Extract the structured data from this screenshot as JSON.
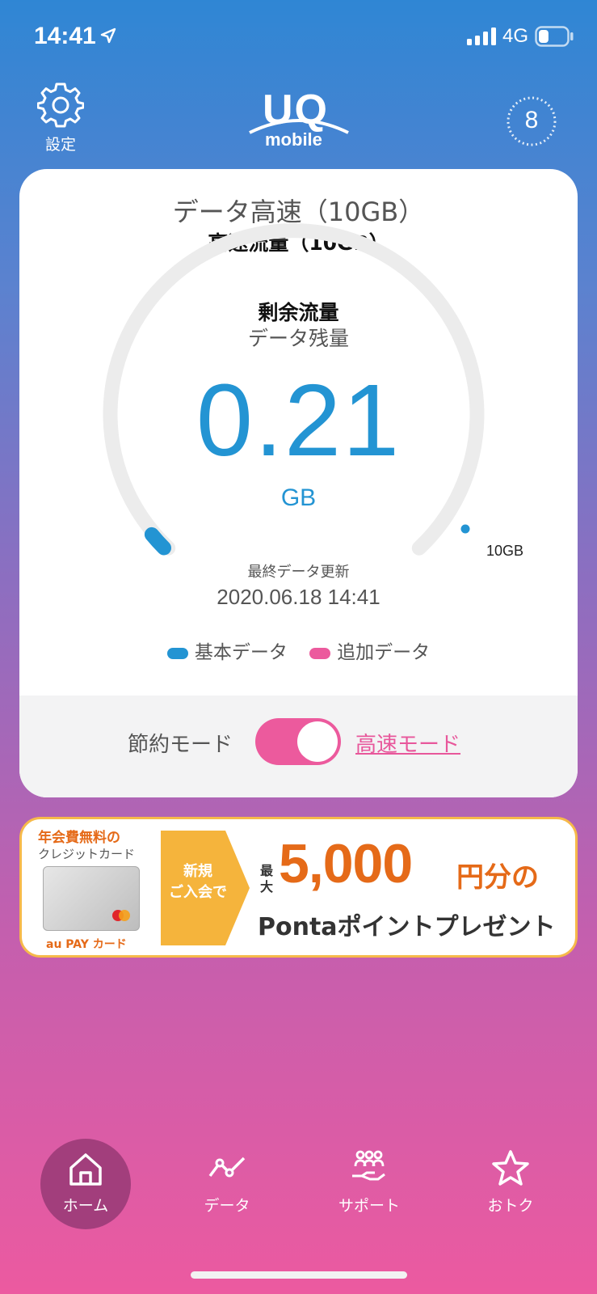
{
  "status_bar": {
    "time": "14:41",
    "network": "4G",
    "battery_level": 0.35,
    "signal_bars": 4
  },
  "header": {
    "settings_label": "設定",
    "logo_top": "UQ",
    "logo_bottom": "mobile",
    "counter": "8"
  },
  "card": {
    "plan_title": "データ高速（10GB）",
    "plan_subtitle": "高速流量（10GB）",
    "remain_label_cn": "剰余流量",
    "remain_label": "データ残量",
    "remain_value": "0.21",
    "remain_unit": "GB",
    "capacity_label": "10GB",
    "remaining_fraction": 0.021,
    "updated_label": "最終データ更新",
    "updated_value": "2020.06.18 14:41",
    "legend": [
      {
        "label": "基本データ",
        "color": "#2394d3"
      },
      {
        "label": "追加データ",
        "color": "#ec5a9d"
      }
    ],
    "mode_left": "節約モード",
    "mode_right": "高速モード",
    "mode_on": true
  },
  "banner": {
    "left_top": "年会費無料の",
    "left_top2": "クレジットカード",
    "brand": "au PAY カード",
    "arrow_text_1": "新規",
    "arrow_text_2": "ご入会で",
    "max_label": "最大",
    "amount": "5,000",
    "amount_suffix": "円分の",
    "bottom_text": "Pontaポイントプレゼント"
  },
  "nav": {
    "items": [
      {
        "label": "ホーム",
        "icon": "home-icon",
        "active": true
      },
      {
        "label": "データ",
        "icon": "chart-line-icon",
        "active": false
      },
      {
        "label": "サポート",
        "icon": "support-icon",
        "active": false
      },
      {
        "label": "おトク",
        "icon": "star-icon",
        "active": false
      }
    ]
  },
  "colors": {
    "accent_blue": "#2394d3",
    "accent_pink": "#ec5a9d",
    "banner_orange": "#e56a18"
  }
}
